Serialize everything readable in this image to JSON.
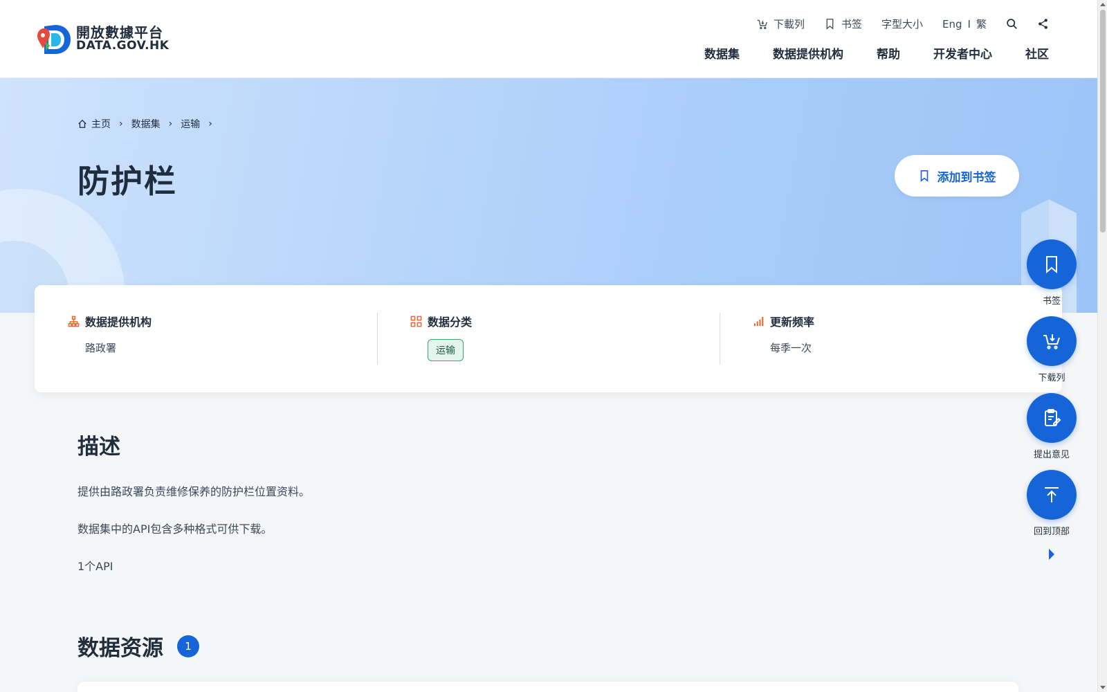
{
  "logo": {
    "cn": "開放數據平台",
    "en": "DATA.GOV.HK"
  },
  "utility": {
    "download_list": "下載列",
    "bookmark": "书签",
    "font_size": "字型大小",
    "lang_en": "Eng",
    "lang_sep": "I",
    "lang_tc": "繁"
  },
  "nav": {
    "items": [
      "数据集",
      "数据提供机构",
      "帮助",
      "开发者中心",
      "社区"
    ]
  },
  "breadcrumb": {
    "home": "主页",
    "datasets": "数据集",
    "category": "运输"
  },
  "page": {
    "title": "防护栏",
    "add_bookmark": "添加到书签"
  },
  "info": {
    "provider_label": "数据提供机构",
    "provider_value": "路政署",
    "category_label": "数据分类",
    "category_value": "运输",
    "frequency_label": "更新频率",
    "frequency_value": "每季一次"
  },
  "description": {
    "title": "描述",
    "line1": "提供由路政署负责维修保养的防护栏位置资料。",
    "line2": "数据集中的API包含多种格式可供下载。",
    "api_count": "1个API"
  },
  "resources": {
    "title": "数据资源",
    "count": "1"
  },
  "float": {
    "bookmark": "书签",
    "download_list": "下载列",
    "feedback": "提出意见",
    "back_to_top": "回到顶部"
  },
  "colors": {
    "accent": "#1565d8",
    "icon_orange": "#f0642d",
    "tag_green": "#3aa57a"
  }
}
